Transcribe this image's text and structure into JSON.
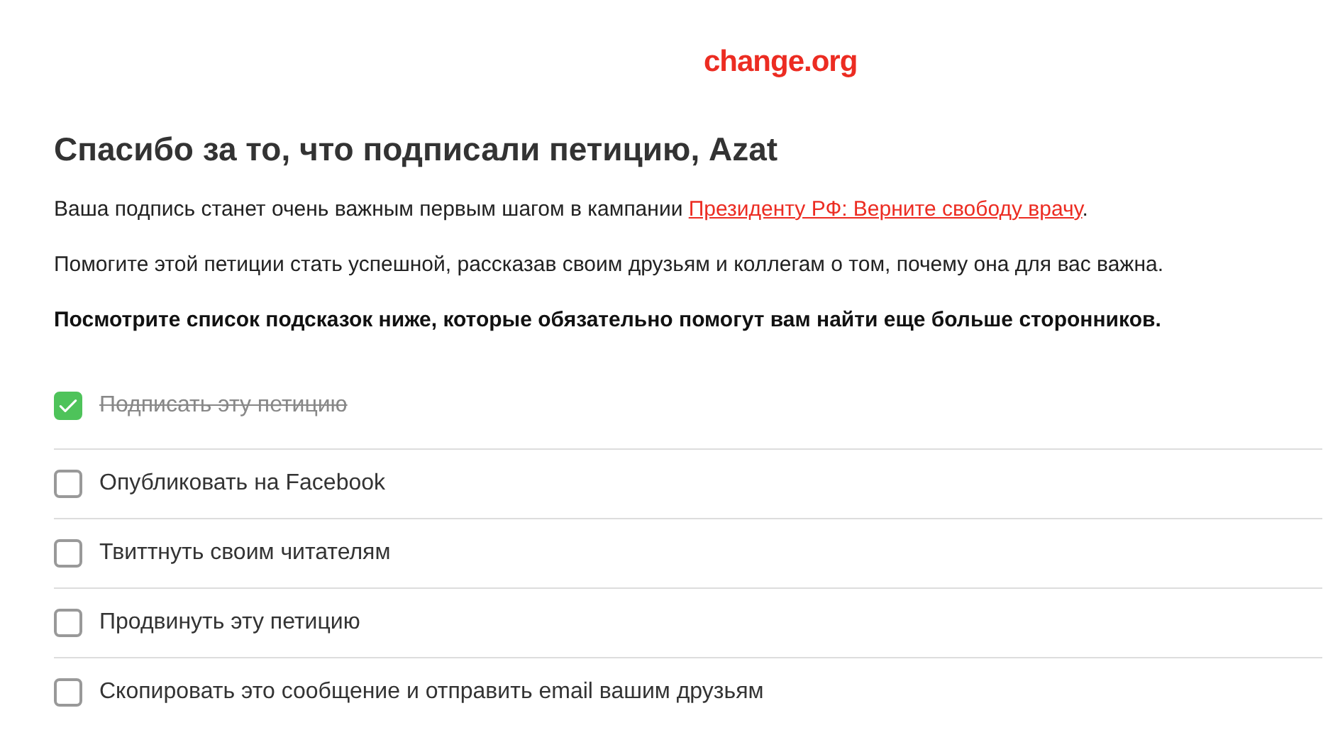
{
  "logo": "change.org",
  "heading": "Спасибо за то, что подписали петицию, Azat",
  "intro": {
    "before": "Ваша подпись станет очень важным первым шагом в кампании ",
    "link": "Президенту РФ: Верните свободу врачу",
    "after": "."
  },
  "help_text": "Помогите этой петиции стать успешной, рассказав своим друзьям и коллегам о том, почему она для вас важна.",
  "tips_heading": "Посмотрите список подсказок ниже, которые обязательно помогут вам найти еще больше сторонников.",
  "checklist": [
    {
      "label": "Подписать эту петицию",
      "checked": true
    },
    {
      "label": "Опубликовать на Facebook",
      "checked": false
    },
    {
      "label": "Твиттнуть своим читателям",
      "checked": false
    },
    {
      "label": "Продвинуть эту петицию",
      "checked": false
    },
    {
      "label": "Скопировать это сообщение и отправить email вашим друзьям",
      "checked": false
    }
  ]
}
